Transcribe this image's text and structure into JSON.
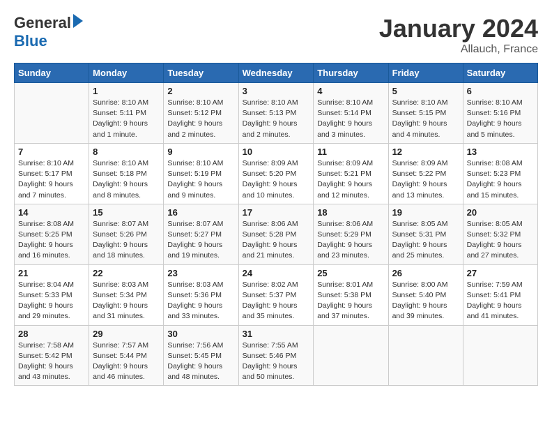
{
  "header": {
    "logo_line1": "General",
    "logo_line2": "Blue",
    "title": "January 2024",
    "subtitle": "Allauch, France"
  },
  "days_of_week": [
    "Sunday",
    "Monday",
    "Tuesday",
    "Wednesday",
    "Thursday",
    "Friday",
    "Saturday"
  ],
  "weeks": [
    [
      {
        "day": "",
        "info": ""
      },
      {
        "day": "1",
        "info": "Sunrise: 8:10 AM\nSunset: 5:11 PM\nDaylight: 9 hours\nand 1 minute."
      },
      {
        "day": "2",
        "info": "Sunrise: 8:10 AM\nSunset: 5:12 PM\nDaylight: 9 hours\nand 2 minutes."
      },
      {
        "day": "3",
        "info": "Sunrise: 8:10 AM\nSunset: 5:13 PM\nDaylight: 9 hours\nand 2 minutes."
      },
      {
        "day": "4",
        "info": "Sunrise: 8:10 AM\nSunset: 5:14 PM\nDaylight: 9 hours\nand 3 minutes."
      },
      {
        "day": "5",
        "info": "Sunrise: 8:10 AM\nSunset: 5:15 PM\nDaylight: 9 hours\nand 4 minutes."
      },
      {
        "day": "6",
        "info": "Sunrise: 8:10 AM\nSunset: 5:16 PM\nDaylight: 9 hours\nand 5 minutes."
      }
    ],
    [
      {
        "day": "7",
        "info": "Sunrise: 8:10 AM\nSunset: 5:17 PM\nDaylight: 9 hours\nand 7 minutes."
      },
      {
        "day": "8",
        "info": "Sunrise: 8:10 AM\nSunset: 5:18 PM\nDaylight: 9 hours\nand 8 minutes."
      },
      {
        "day": "9",
        "info": "Sunrise: 8:10 AM\nSunset: 5:19 PM\nDaylight: 9 hours\nand 9 minutes."
      },
      {
        "day": "10",
        "info": "Sunrise: 8:09 AM\nSunset: 5:20 PM\nDaylight: 9 hours\nand 10 minutes."
      },
      {
        "day": "11",
        "info": "Sunrise: 8:09 AM\nSunset: 5:21 PM\nDaylight: 9 hours\nand 12 minutes."
      },
      {
        "day": "12",
        "info": "Sunrise: 8:09 AM\nSunset: 5:22 PM\nDaylight: 9 hours\nand 13 minutes."
      },
      {
        "day": "13",
        "info": "Sunrise: 8:08 AM\nSunset: 5:23 PM\nDaylight: 9 hours\nand 15 minutes."
      }
    ],
    [
      {
        "day": "14",
        "info": "Sunrise: 8:08 AM\nSunset: 5:25 PM\nDaylight: 9 hours\nand 16 minutes."
      },
      {
        "day": "15",
        "info": "Sunrise: 8:07 AM\nSunset: 5:26 PM\nDaylight: 9 hours\nand 18 minutes."
      },
      {
        "day": "16",
        "info": "Sunrise: 8:07 AM\nSunset: 5:27 PM\nDaylight: 9 hours\nand 19 minutes."
      },
      {
        "day": "17",
        "info": "Sunrise: 8:06 AM\nSunset: 5:28 PM\nDaylight: 9 hours\nand 21 minutes."
      },
      {
        "day": "18",
        "info": "Sunrise: 8:06 AM\nSunset: 5:29 PM\nDaylight: 9 hours\nand 23 minutes."
      },
      {
        "day": "19",
        "info": "Sunrise: 8:05 AM\nSunset: 5:31 PM\nDaylight: 9 hours\nand 25 minutes."
      },
      {
        "day": "20",
        "info": "Sunrise: 8:05 AM\nSunset: 5:32 PM\nDaylight: 9 hours\nand 27 minutes."
      }
    ],
    [
      {
        "day": "21",
        "info": "Sunrise: 8:04 AM\nSunset: 5:33 PM\nDaylight: 9 hours\nand 29 minutes."
      },
      {
        "day": "22",
        "info": "Sunrise: 8:03 AM\nSunset: 5:34 PM\nDaylight: 9 hours\nand 31 minutes."
      },
      {
        "day": "23",
        "info": "Sunrise: 8:03 AM\nSunset: 5:36 PM\nDaylight: 9 hours\nand 33 minutes."
      },
      {
        "day": "24",
        "info": "Sunrise: 8:02 AM\nSunset: 5:37 PM\nDaylight: 9 hours\nand 35 minutes."
      },
      {
        "day": "25",
        "info": "Sunrise: 8:01 AM\nSunset: 5:38 PM\nDaylight: 9 hours\nand 37 minutes."
      },
      {
        "day": "26",
        "info": "Sunrise: 8:00 AM\nSunset: 5:40 PM\nDaylight: 9 hours\nand 39 minutes."
      },
      {
        "day": "27",
        "info": "Sunrise: 7:59 AM\nSunset: 5:41 PM\nDaylight: 9 hours\nand 41 minutes."
      }
    ],
    [
      {
        "day": "28",
        "info": "Sunrise: 7:58 AM\nSunset: 5:42 PM\nDaylight: 9 hours\nand 43 minutes."
      },
      {
        "day": "29",
        "info": "Sunrise: 7:57 AM\nSunset: 5:44 PM\nDaylight: 9 hours\nand 46 minutes."
      },
      {
        "day": "30",
        "info": "Sunrise: 7:56 AM\nSunset: 5:45 PM\nDaylight: 9 hours\nand 48 minutes."
      },
      {
        "day": "31",
        "info": "Sunrise: 7:55 AM\nSunset: 5:46 PM\nDaylight: 9 hours\nand 50 minutes."
      },
      {
        "day": "",
        "info": ""
      },
      {
        "day": "",
        "info": ""
      },
      {
        "day": "",
        "info": ""
      }
    ]
  ]
}
